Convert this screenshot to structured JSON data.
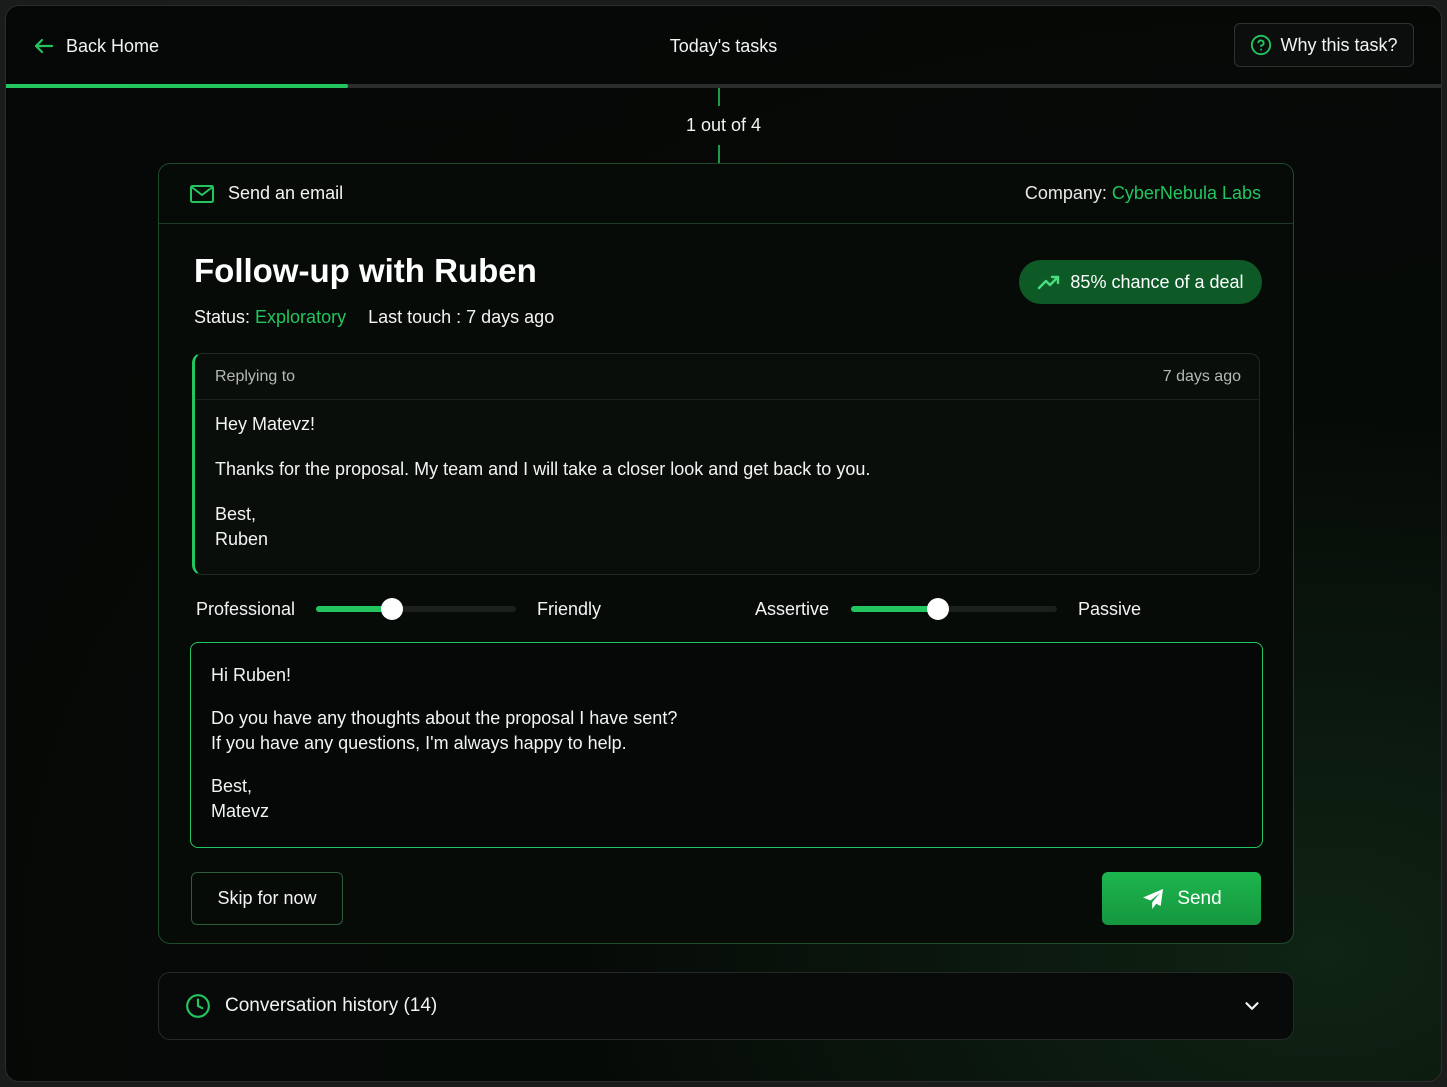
{
  "header": {
    "back_label": "Back Home",
    "title": "Today's tasks",
    "why_label": "Why this task?"
  },
  "progress": {
    "current": 1,
    "total": 4,
    "fraction": 0.25,
    "step_text": "1 out of 4"
  },
  "task": {
    "type_label": "Send an email",
    "company_prefix": "Company: ",
    "company_name": "CyberNebula Labs",
    "title": "Follow-up with Ruben",
    "status_prefix": "Status: ",
    "status_value": "Exploratory",
    "last_touch": "Last touch : 7 days ago",
    "chance_label": "85% chance of a deal"
  },
  "reply": {
    "header_label": "Replying to",
    "time": "7 days ago",
    "greeting": "Hey Matevz!",
    "body": "Thanks for the proposal. My team and I will take a closer look and get back to you.",
    "signoff": "Best,",
    "signature": "Ruben"
  },
  "tone": {
    "slider1": {
      "left_label": "Professional",
      "right_label": "Friendly",
      "value": 0.38
    },
    "slider2": {
      "left_label": "Assertive",
      "right_label": "Passive",
      "value": 0.42
    }
  },
  "compose": {
    "greeting": "Hi Ruben!",
    "line1": "Do you have any thoughts about the proposal I have sent?",
    "line2": "If you have any questions, I'm always happy to help.",
    "signoff": "Best,",
    "signature": "Matevz"
  },
  "actions": {
    "skip_label": "Skip for now",
    "send_label": "Send"
  },
  "history": {
    "label": "Conversation history (14)"
  },
  "colors": {
    "accent": "#22c55e",
    "chance_bg": "#0d5a26",
    "background": "#050706"
  },
  "icons": [
    "arrow-left-icon",
    "question-circle-icon",
    "mail-icon",
    "trending-up-icon",
    "send-icon",
    "clock-icon",
    "chevron-down-icon"
  ]
}
